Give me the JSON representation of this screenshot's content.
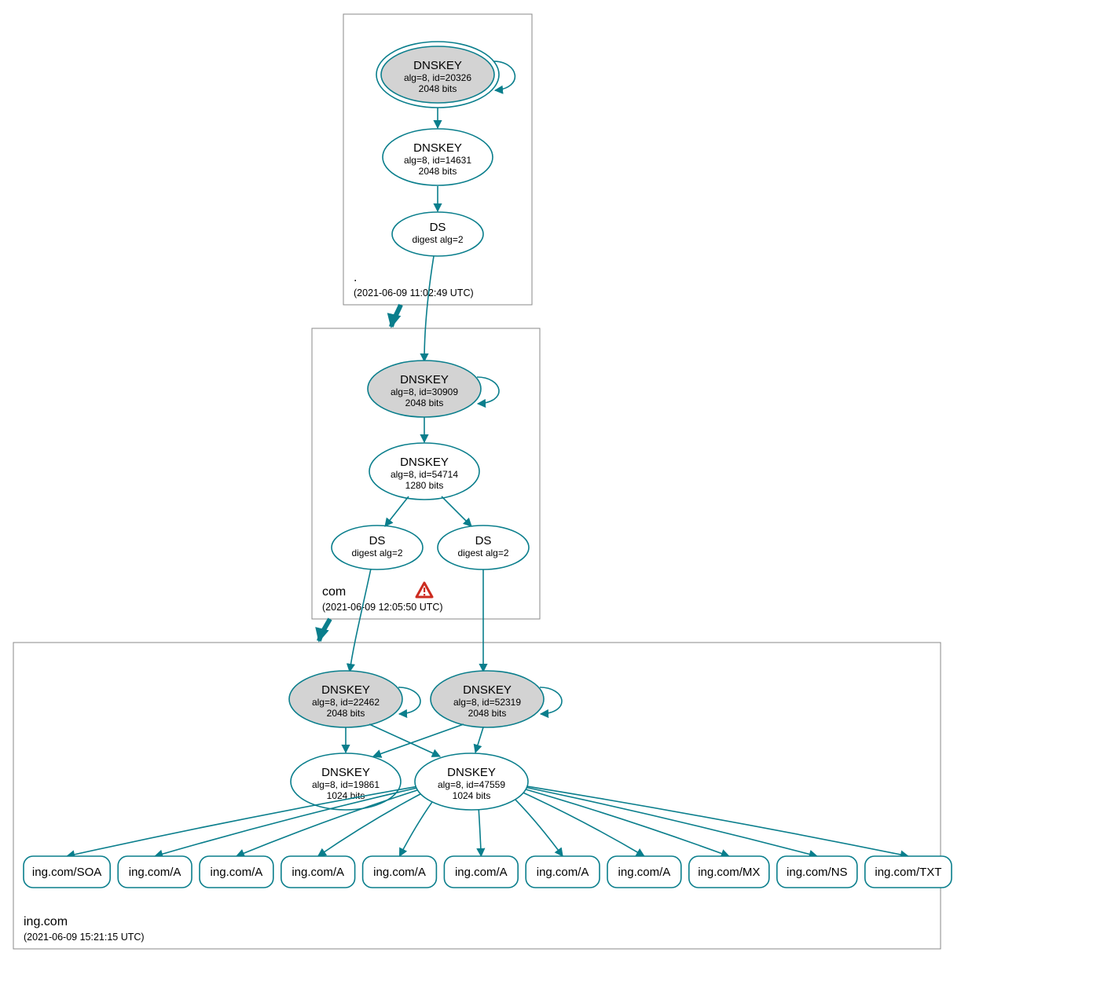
{
  "colors": {
    "accent": "#0a7e8c",
    "box": "#888888",
    "fill": "#d3d3d3",
    "warn": "#cc2b1f"
  },
  "zones": {
    "root": {
      "label": ".",
      "timestamp": "(2021-06-09 11:02:49 UTC)"
    },
    "com": {
      "label": "com",
      "timestamp": "(2021-06-09 12:05:50 UTC)"
    },
    "ing": {
      "label": "ing.com",
      "timestamp": "(2021-06-09 15:21:15 UTC)"
    }
  },
  "nodes": {
    "root_ksk": {
      "title": "DNSKEY",
      "sub1": "alg=8, id=20326",
      "sub2": "2048 bits"
    },
    "root_zsk": {
      "title": "DNSKEY",
      "sub1": "alg=8, id=14631",
      "sub2": "2048 bits"
    },
    "root_ds": {
      "title": "DS",
      "sub1": "digest alg=2"
    },
    "com_ksk": {
      "title": "DNSKEY",
      "sub1": "alg=8, id=30909",
      "sub2": "2048 bits"
    },
    "com_zsk": {
      "title": "DNSKEY",
      "sub1": "alg=8, id=54714",
      "sub2": "1280 bits"
    },
    "com_ds1": {
      "title": "DS",
      "sub1": "digest alg=2"
    },
    "com_ds2": {
      "title": "DS",
      "sub1": "digest alg=2"
    },
    "ing_ksk1": {
      "title": "DNSKEY",
      "sub1": "alg=8, id=22462",
      "sub2": "2048 bits"
    },
    "ing_ksk2": {
      "title": "DNSKEY",
      "sub1": "alg=8, id=52319",
      "sub2": "2048 bits"
    },
    "ing_zsk1": {
      "title": "DNSKEY",
      "sub1": "alg=8, id=19861",
      "sub2": "1024 bits"
    },
    "ing_zsk2": {
      "title": "DNSKEY",
      "sub1": "alg=8, id=47559",
      "sub2": "1024 bits"
    }
  },
  "records": [
    "ing.com/SOA",
    "ing.com/A",
    "ing.com/A",
    "ing.com/A",
    "ing.com/A",
    "ing.com/A",
    "ing.com/A",
    "ing.com/A",
    "ing.com/MX",
    "ing.com/NS",
    "ing.com/TXT"
  ]
}
